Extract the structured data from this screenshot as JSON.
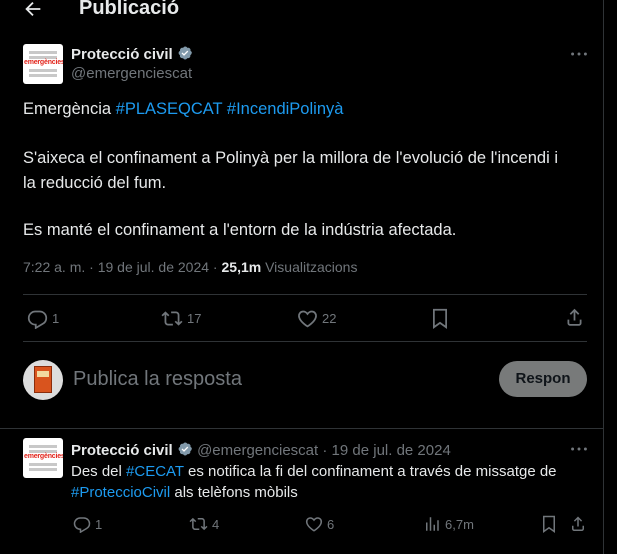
{
  "header": {
    "title": "Publicació"
  },
  "main_tweet": {
    "author_name": "Protecció civil",
    "author_handle": "@emergenciescat",
    "logo_text": "emergències",
    "line1_prefix": "Emergència ",
    "hashtag1": "#PLASEQCAT",
    "hashtag2": "#IncendiPolinyà",
    "para2_line1": "S'aixeca el confinament a Polinyà per la millora de l'evolució de l'incendi i",
    "para2_line2": "la reducció del fum.",
    "para3": "Es manté el confinament a l'entorn de la indústria afectada.",
    "time": "7:22 a. m.",
    "date": "19 de jul. de 2024",
    "views_count": "25,1m",
    "views_label": "Visualitzacions",
    "replies": "1",
    "retweets": "17",
    "likes": "22"
  },
  "reply_box": {
    "placeholder": "Publica la resposta",
    "button": "Respon"
  },
  "reply_tweet": {
    "author_name": "Protecció civil",
    "author_handle": "@emergenciescat",
    "date": "19 de jul. de 2024",
    "text_prefix": "Des del ",
    "hashtag1": "#CECAT",
    "text_mid": " es notifica la fi del confinament a través de missatge de",
    "hashtag2": "#ProteccioCivil",
    "text_suffix": " als telèfons mòbils",
    "replies": "1",
    "retweets": "4",
    "likes": "6",
    "views": "6,7m"
  },
  "colors": {
    "accent": "#1d9bf0",
    "muted": "#71767b",
    "text": "#e7e9ea",
    "border": "#2f3336"
  },
  "icons": [
    "back-arrow-icon",
    "verified-badge-icon",
    "more-icon",
    "reply-icon",
    "retweet-icon",
    "like-icon",
    "bookmark-icon",
    "share-icon",
    "views-icon"
  ]
}
